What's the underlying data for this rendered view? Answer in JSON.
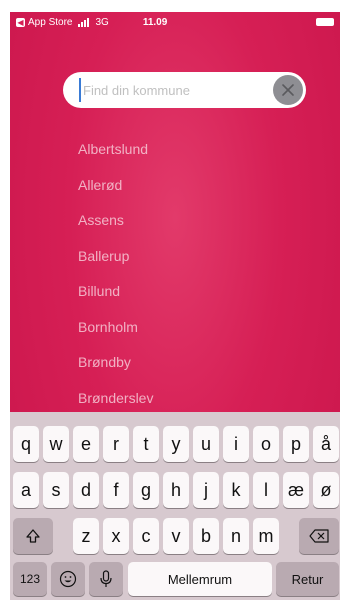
{
  "status_bar": {
    "back_app": "App Store",
    "network": "3G",
    "time": "11.09"
  },
  "search": {
    "placeholder": "Find din kommune",
    "value": ""
  },
  "municipalities": [
    "Albertslund",
    "Allerød",
    "Assens",
    "Ballerup",
    "Billund",
    "Bornholm",
    "Brøndby",
    "Brønderslev"
  ],
  "keyboard": {
    "row1": [
      "q",
      "w",
      "e",
      "r",
      "t",
      "y",
      "u",
      "i",
      "o",
      "p",
      "å"
    ],
    "row2": [
      "a",
      "s",
      "d",
      "f",
      "g",
      "h",
      "j",
      "k",
      "l",
      "æ",
      "ø"
    ],
    "row3": [
      "z",
      "x",
      "c",
      "v",
      "b",
      "n",
      "m"
    ],
    "numbers_label": "123",
    "space_label": "Mellemrum",
    "return_label": "Retur"
  },
  "colors": {
    "background": "#d61f55",
    "keyboard": "#d7c9cf"
  }
}
